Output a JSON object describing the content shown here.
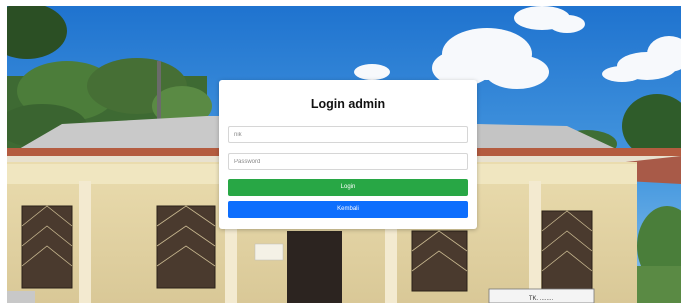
{
  "login": {
    "title": "Login admin",
    "nik_placeholder": "nik",
    "password_placeholder": "Password",
    "login_button": "Login",
    "back_button": "Kembali"
  },
  "background": {
    "sign_text": "TK. ........"
  },
  "colors": {
    "login_button": "#28a745",
    "back_button": "#0d6efd",
    "sky": "#2f86d6",
    "wall": "#e6d8a8",
    "roof": "#b8b8b8",
    "roof_trim": "#b85a3f"
  }
}
